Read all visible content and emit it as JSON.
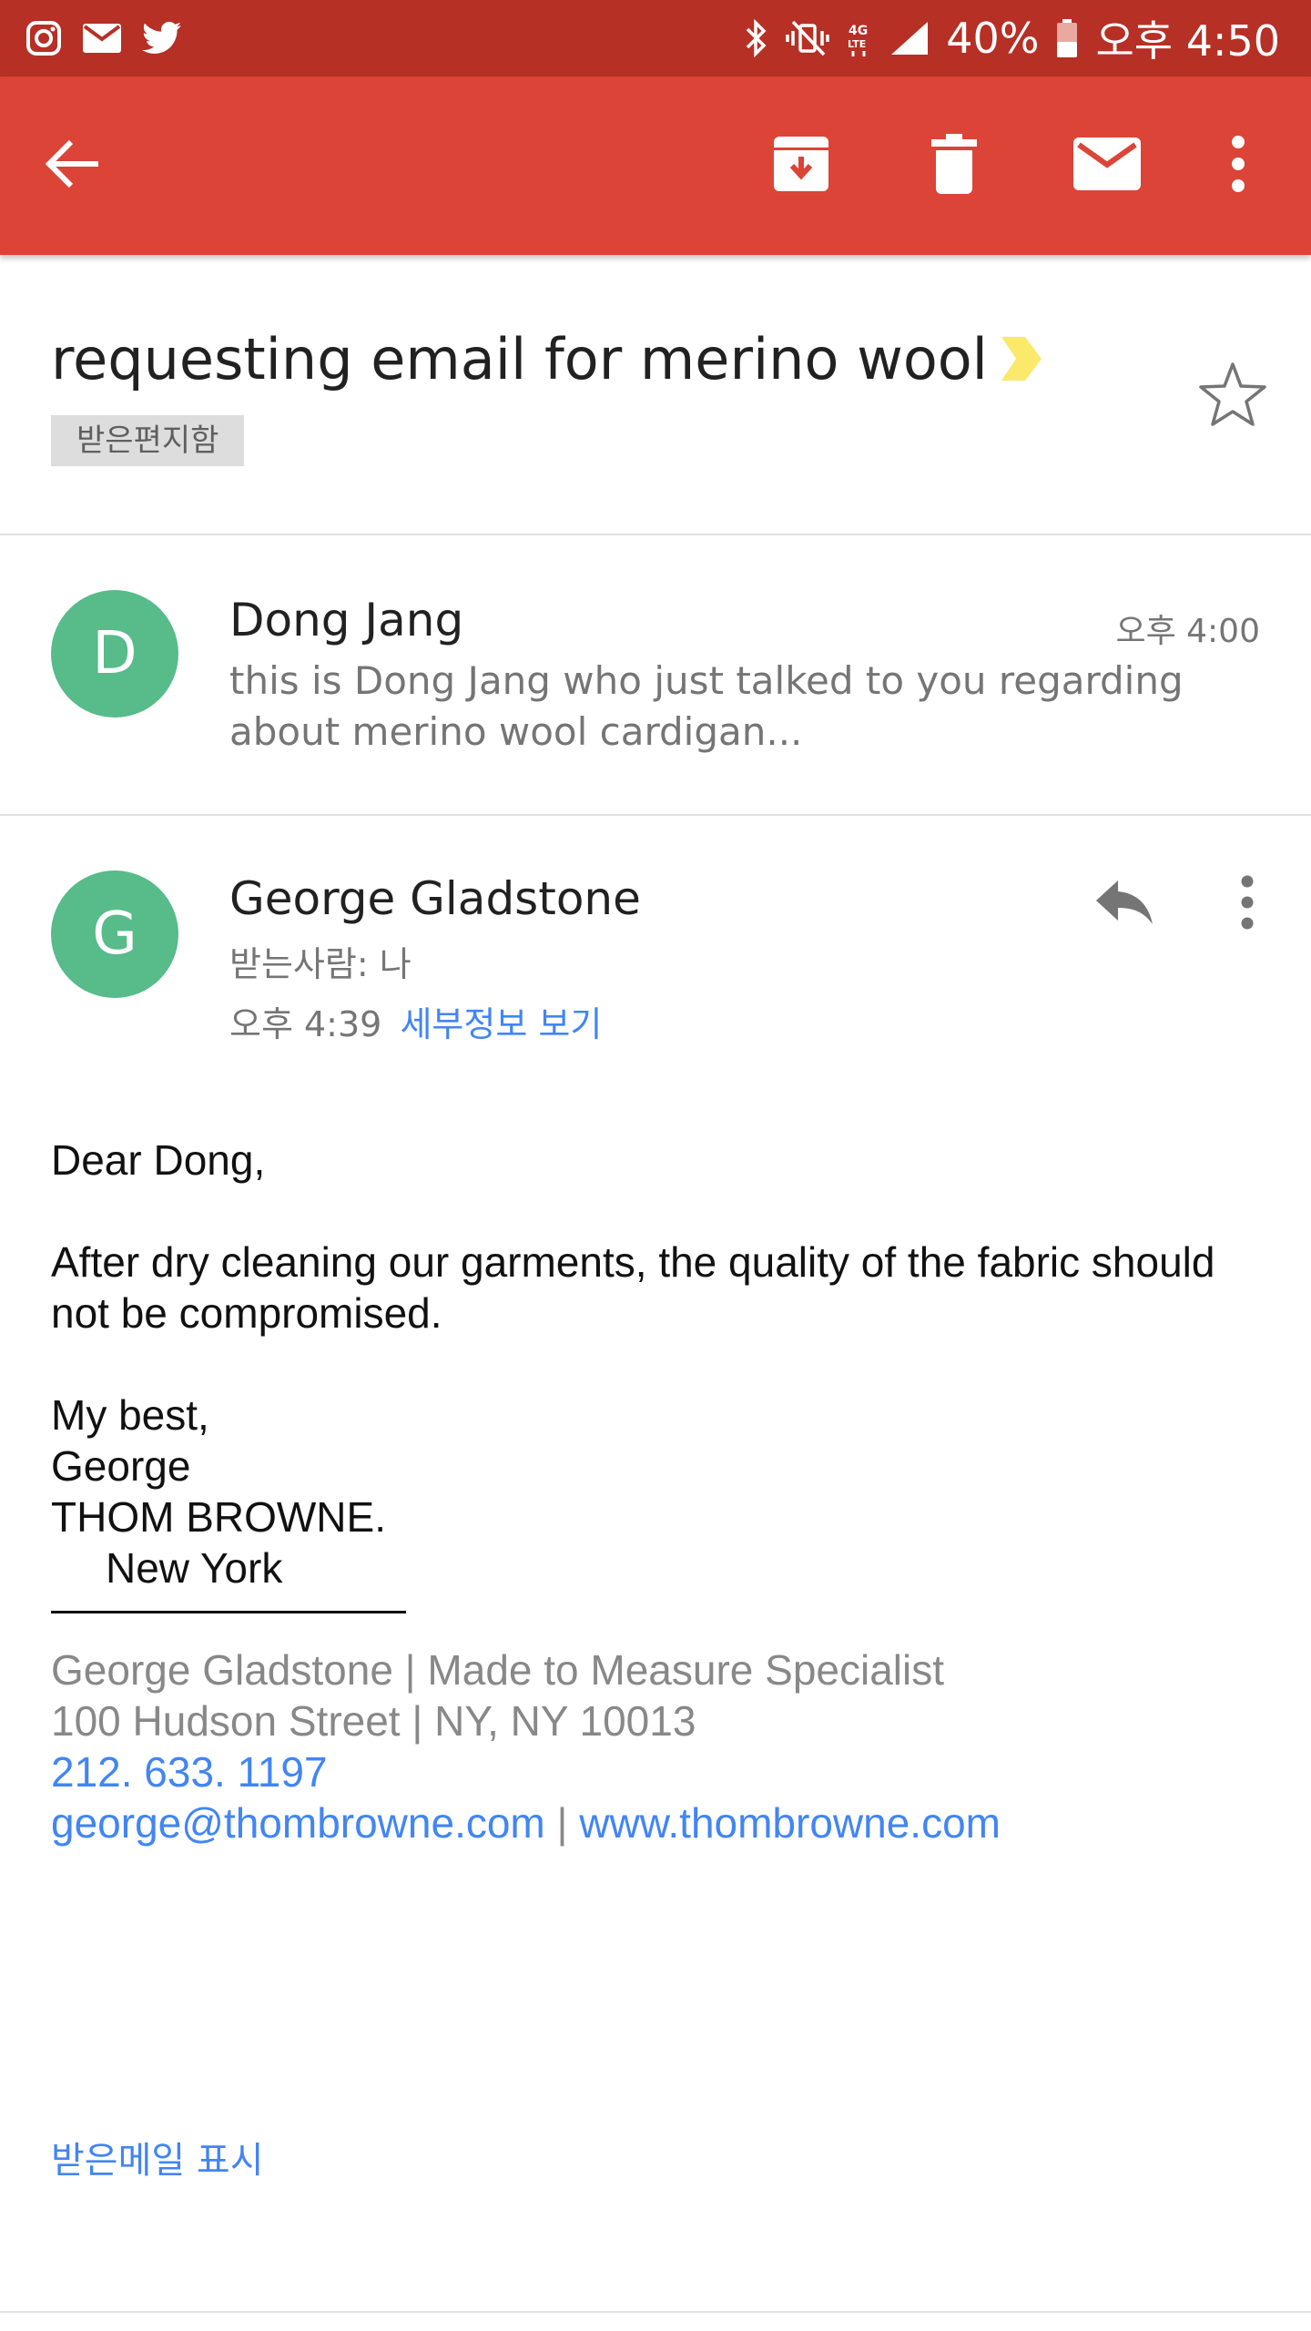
{
  "status_bar": {
    "icons_left": [
      "instagram-icon",
      "mail-icon",
      "twitter-icon"
    ],
    "icons_right": [
      "bluetooth-icon",
      "vibrate-off-icon",
      "lte-icon",
      "signal-icon",
      "battery-icon"
    ],
    "battery": "40%",
    "time": "오후 4:50"
  },
  "toolbar": {
    "back": "arrow-back-icon",
    "actions": [
      "archive-icon",
      "delete-icon",
      "mark-unread-icon",
      "more-vert-icon"
    ],
    "color": "#db4437"
  },
  "subject": {
    "text": "requesting email for merino wool",
    "label": "받은편지함"
  },
  "messages": [
    {
      "avatar": "D",
      "sender": "Dong Jang",
      "time": "오후 4:00",
      "snippet": "this is Dong Jang who just talked to you regarding about merino wool cardigan..."
    },
    {
      "avatar": "G",
      "sender": "George Gladstone",
      "to": "받는사람: 나",
      "time": "오후 4:39",
      "details_link": "세부정보 보기",
      "body": {
        "greeting": "Dear Dong,",
        "paragraph": "After dry cleaning our garments, the quality of the fabric should not be compromised.",
        "closing": "My best,",
        "name": "George",
        "brand": "THOM BROWNE.",
        "city": "New York",
        "divider": "____________________"
      },
      "signature": {
        "line1": "George Gladstone | Made to Measure Specialist",
        "line2": "100 Hudson Street | NY, NY 10013",
        "phone": "212. 633. 1197",
        "email": "george@thombrowne.com",
        "separator": "|",
        "website": "www.thombrowne.com"
      },
      "show_quoted": "받은메일 표시"
    }
  ],
  "colors": {
    "status_bar": "#b63025",
    "toolbar": "#db4437",
    "avatar": "#57bb8a",
    "link": "#4285f4"
  }
}
